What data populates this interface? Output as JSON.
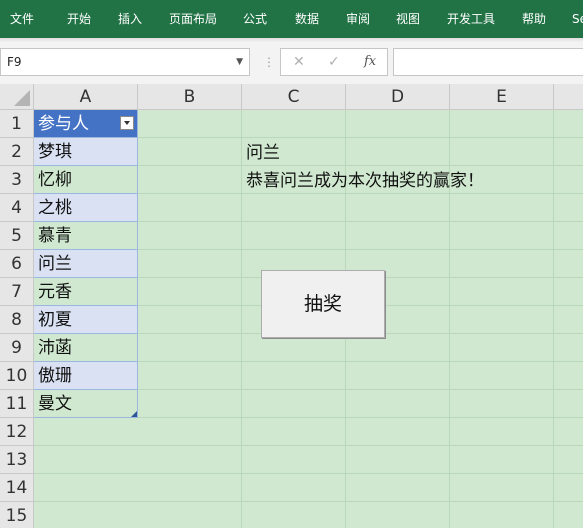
{
  "ribbon": {
    "tabs": [
      "文件",
      "开始",
      "插入",
      "页面布局",
      "公式",
      "数据",
      "审阅",
      "视图",
      "开发工具",
      "帮助",
      "Se"
    ]
  },
  "formula_bar": {
    "name_box": "F9",
    "name_box_dropdown": "▼",
    "separator": "⋮",
    "cancel": "✕",
    "enter": "✓",
    "fx": "fx",
    "formula": ""
  },
  "sheet": {
    "columns": [
      "A",
      "B",
      "C",
      "D",
      "E"
    ],
    "rows": [
      "1",
      "2",
      "3",
      "4",
      "5",
      "6",
      "7",
      "8",
      "9",
      "10",
      "11",
      "12",
      "13",
      "14",
      "15"
    ],
    "table_header": "参与人",
    "participants": [
      "梦琪",
      "忆柳",
      "之桃",
      "慕青",
      "问兰",
      "元香",
      "初夏",
      "沛菡",
      "傲珊",
      "曼文"
    ],
    "winner_name": "问兰",
    "winner_message": "恭喜问兰成为本次抽奖的赢家！",
    "draw_button_label": "抽奖"
  },
  "colors": {
    "ribbon": "#217346",
    "sheet_background": "#cfe8cf",
    "table_header": "#4472c4",
    "table_band": "#d9e1f2"
  }
}
